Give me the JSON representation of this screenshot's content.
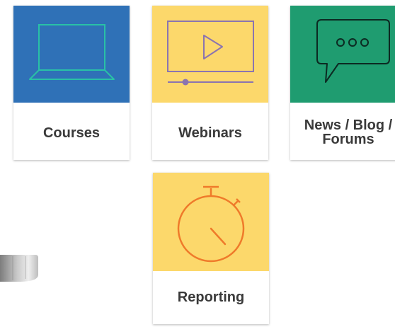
{
  "tiles": [
    {
      "label": "Courses",
      "icon": "laptop-icon",
      "color": "#2f71b7"
    },
    {
      "label": "Webinars",
      "icon": "video-player-icon",
      "color": "#fcd86b"
    },
    {
      "label_line1": "News / Blog /",
      "label_line2": "Forums",
      "icon": "chat-bubble-icon",
      "color": "#1f9c70"
    },
    {
      "label": "Reporting",
      "icon": "stopwatch-icon",
      "color": "#fcd86b"
    }
  ],
  "colors": {
    "courses_icon": "#29c1a6",
    "webinars_icon": "#8b74b0",
    "news_icon": "#0c2a22",
    "reporting_icon": "#ef7a2a",
    "label_text": "#3a3a3a"
  }
}
